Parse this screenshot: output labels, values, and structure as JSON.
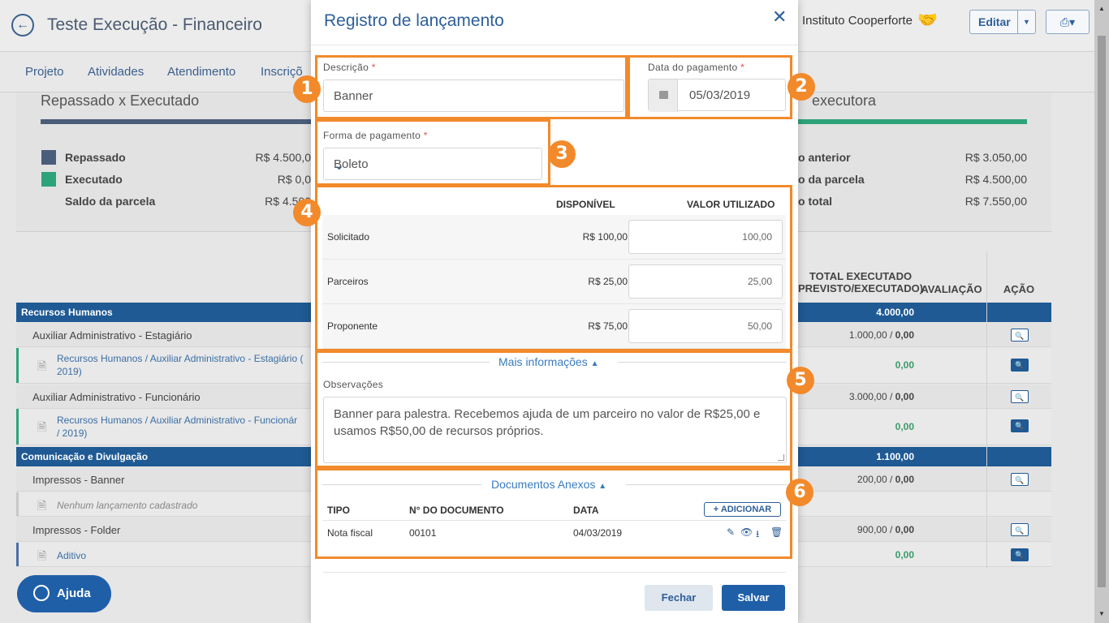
{
  "header": {
    "title": "Teste Execução - Financeiro",
    "org": "Instituto Cooperforte",
    "edit_label": "Editar"
  },
  "nav": [
    "Projeto",
    "Atividades",
    "Atendimento",
    "Inscriçõ"
  ],
  "summary": {
    "left_title": "Repassado x Executado",
    "right_title": "executora",
    "left_rows": [
      {
        "label": "Repassado",
        "value": "R$ 4.500,0"
      },
      {
        "label": "Executado",
        "value": "R$ 0,0"
      },
      {
        "label": "Saldo da parcela",
        "value": "R$ 4.500"
      }
    ],
    "right_rows": [
      {
        "label": "o anterior",
        "value": "R$ 3.050,00"
      },
      {
        "label": "o da parcela",
        "value": "R$ 4.500,00"
      },
      {
        "label": "o total",
        "value": "R$ 7.550,00"
      }
    ],
    "colors": {
      "repassado": "#4a5d7a",
      "executado": "#2ea37a"
    }
  },
  "table": {
    "headers": {
      "total_line1": "TOTAL EXECUTADO",
      "total_line2": "PREVISTO/EXECUTADO)",
      "avaliacao": "AVALIAÇÃO",
      "acao": "AÇÃO"
    },
    "groups": [
      {
        "name": "Recursos Humanos",
        "total": "4.000,00"
      },
      {
        "name": "Comunicação e Divulgação",
        "total": "1.100,00"
      }
    ],
    "subs": [
      {
        "name": "Auxiliar Administrativo - Estagiário",
        "prev": "1.000,00 / ",
        "exec": "0,00"
      },
      {
        "name": "Auxiliar Administrativo - Funcionário",
        "prev": "3.000,00 / ",
        "exec": "0,00"
      },
      {
        "name": "Impressos - Banner",
        "prev": "200,00 / ",
        "exec": "0,00"
      },
      {
        "name": "Impressos - Folder",
        "prev": "900,00 / ",
        "exec": "0,00"
      }
    ],
    "items": [
      {
        "line1": "Recursos Humanos / Auxiliar Administrativo - Estagiário (",
        "line2": "2019)",
        "value": "0,00"
      },
      {
        "line1": "Recursos Humanos / Auxiliar Administrativo - Funcionár",
        "line2": "/ 2019)",
        "value": "0,00"
      },
      {
        "line1": "Nenhum lançamento cadastrado",
        "line2": "",
        "value": ""
      },
      {
        "line1": "Aditivo",
        "line2": "",
        "value": "0,00"
      }
    ]
  },
  "help": {
    "label": "Ajuda"
  },
  "modal": {
    "title": "Registro de lançamento",
    "descricao_label": "Descrição",
    "descricao_value": "Banner",
    "data_label": "Data do pagamento",
    "data_value": "05/03/2019",
    "forma_label": "Forma de pagamento",
    "forma_value": "Boleto",
    "col_disponivel": "DISPONÍVEL",
    "col_valor": "VALOR UTILIZADO",
    "rows": [
      {
        "name": "Solicitado",
        "disponivel": "R$ 100,00",
        "valor": "100,00"
      },
      {
        "name": "Parceiros",
        "disponivel": "R$ 25,00",
        "valor": "25,00"
      },
      {
        "name": "Proponente",
        "disponivel": "R$ 75,00",
        "valor": "50,00"
      }
    ],
    "mais_info": "Mais informações",
    "obs_label": "Observações",
    "obs_value": "Banner para palestra. Recebemos ajuda de um parceiro no valor de R$25,00 e usamos R$50,00 de recursos próprios.",
    "docs_title": "Documentos Anexos",
    "docs_headers": {
      "tipo": "TIPO",
      "numero": "N° DO DOCUMENTO",
      "data": "DATA"
    },
    "add_label": "ADICIONAR",
    "docs": [
      {
        "tipo": "Nota fiscal",
        "numero": "00101",
        "data": "04/03/2019"
      }
    ],
    "btn_close": "Fechar",
    "btn_save": "Salvar"
  },
  "annotations": [
    "1",
    "2",
    "3",
    "4",
    "5",
    "6"
  ],
  "colors": {
    "accent": "#f28a2b",
    "primary": "#1f5fa8",
    "success": "#2ea37a"
  }
}
